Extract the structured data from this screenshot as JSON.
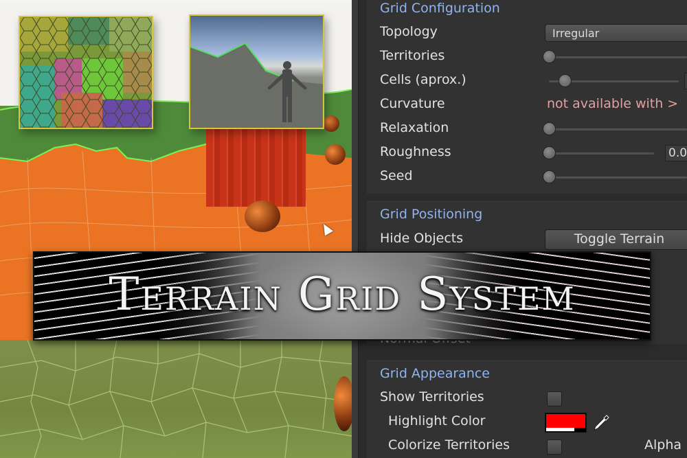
{
  "banner": {
    "title": "Terrain Grid System"
  },
  "scene": {
    "description": "terrain-viewport",
    "cursor": "arrow-cursor"
  },
  "inspector": {
    "sections": {
      "grid_configuration": {
        "title": "Grid Configuration",
        "rows": {
          "topology": {
            "label": "Topology",
            "value": "Irregular"
          },
          "territories": {
            "label": "Territories",
            "slider_fraction": 0.0
          },
          "cells": {
            "label": "Cells (aprox.)",
            "slider_fraction": 0.13
          },
          "curvature": {
            "label": "Curvature",
            "warning": "not available with >"
          },
          "relaxation": {
            "label": "Relaxation",
            "slider_fraction": 0.0
          },
          "roughness": {
            "label": "Roughness",
            "slider_fraction": 0.0,
            "value": "0.0"
          },
          "seed": {
            "label": "Seed",
            "slider_fraction": 0.0
          }
        }
      },
      "grid_positioning": {
        "title": "Grid Positioning",
        "rows": {
          "hide_objects": {
            "label": "Hide Objects",
            "button": "Toggle Terrain"
          },
          "normal_offset": {
            "label": "Normal Offset"
          }
        }
      },
      "grid_appearance": {
        "title": "Grid Appearance",
        "rows": {
          "show_territories": {
            "label": "Show Territories",
            "checked": false
          },
          "highlight_color": {
            "label": "Highlight Color",
            "color": "#ff0000"
          },
          "colorize_territories": {
            "label": "Colorize Territories",
            "checked": false,
            "alpha_label": "Alpha"
          }
        }
      }
    }
  },
  "colors": {
    "section_title": "#8fb4f0",
    "warning_text": "#e2a1a1",
    "highlight": "#ff0000",
    "panel_bg": "#2b2b2b"
  }
}
